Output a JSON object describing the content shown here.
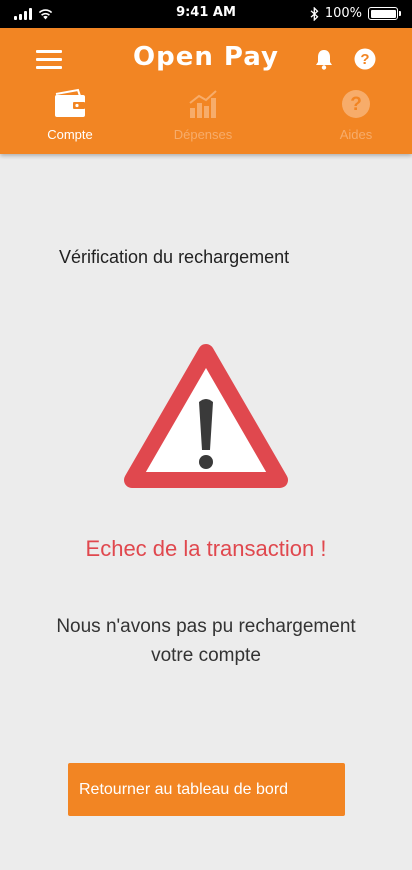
{
  "status_bar": {
    "time": "9:41 AM",
    "battery_text": "100%",
    "battery_level": 1.0,
    "icons": [
      "signal-icon",
      "wifi-icon",
      "bluetooth-icon",
      "battery-icon"
    ]
  },
  "header": {
    "brand": "Open Pay",
    "background_color": "#f28523",
    "icons": [
      "menu-icon",
      "bell-icon",
      "help-icon"
    ]
  },
  "tabs": [
    {
      "label": "Compte",
      "icon": "wallet-icon",
      "active": true
    },
    {
      "label": "Dépenses",
      "icon": "bar-chart-icon",
      "active": false
    },
    {
      "label": "Aides",
      "icon": "help-icon",
      "active": false
    }
  ],
  "main": {
    "subtitle": "Vérification du rechargement",
    "warning_icon": "warning-triangle-icon",
    "error_title": "Echec de la transaction !",
    "error_message": "Nous n'avons pas pu rechargement votre compte",
    "error_color": "#e0484e",
    "button_label": "Retourner au tableau de bord"
  }
}
